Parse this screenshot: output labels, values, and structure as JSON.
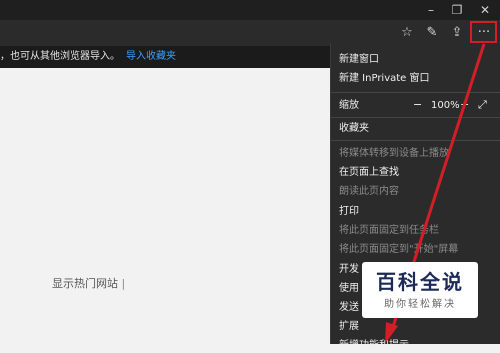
{
  "window": {
    "minimize_icon": "minimize-icon",
    "restore_icon": "restore-icon",
    "close_icon": "close-icon"
  },
  "toolbar": {
    "icons": [
      "favorites-icon",
      "pen-icon",
      "share-icon",
      "more-icon"
    ]
  },
  "favbar": {
    "text": "，也可从其他浏览器导入。",
    "link": "导入收藏夹"
  },
  "content": {
    "sites_label": "显示热门网站"
  },
  "menu": {
    "new_window": "新建窗口",
    "new_inprivate": "新建 InPrivate 窗口",
    "zoom_label": "缩放",
    "zoom_minus": "−",
    "zoom_value": "100%",
    "zoom_plus": "+",
    "favorites": "收藏夹",
    "cast": "将媒体转移到设备上播放",
    "find": "在页面上查找",
    "read_aloud": "朗读此页内容",
    "print": "打印",
    "pin_taskbar": "将此页面固定到任务栏",
    "pin_start": "将此页面固定到\"开始\"屏幕",
    "tools_partial": "开发",
    "use_partial": "使用",
    "send_partial": "发送",
    "extensions": "扩展",
    "more_tools_partial": "新增功能和提示"
  },
  "watermark": {
    "title": "百科全说",
    "subtitle": "助你轻松解决"
  },
  "colors": {
    "annotation_red": "#d21f26",
    "link_blue": "#3aa0ff",
    "menu_bg": "#2b2b2b"
  }
}
